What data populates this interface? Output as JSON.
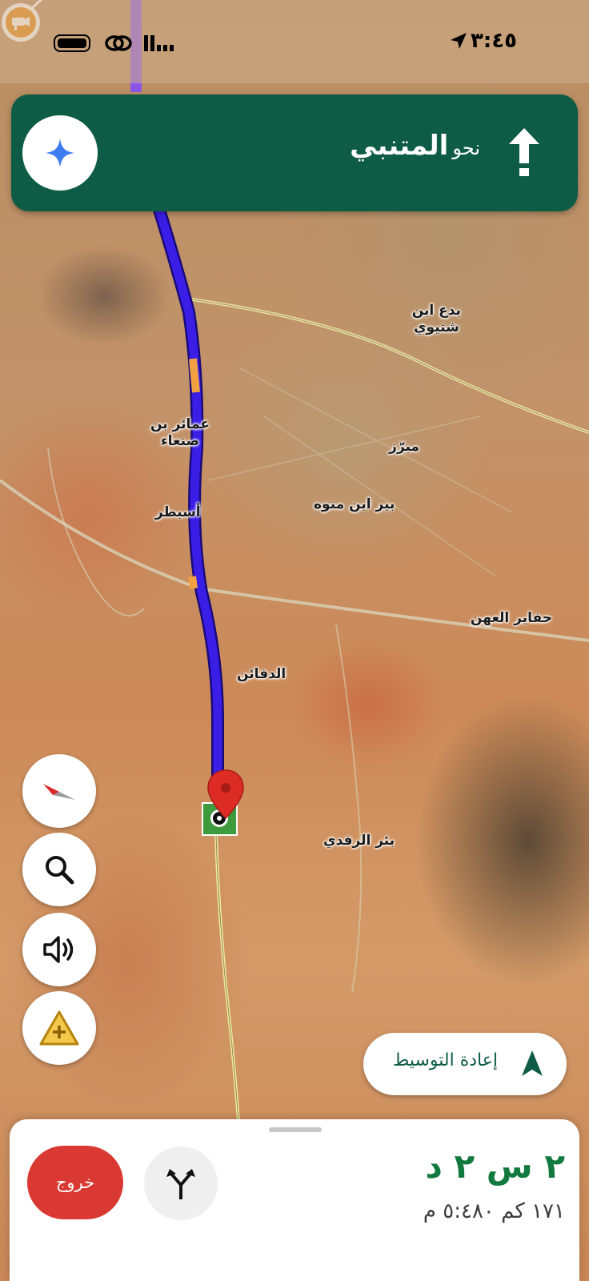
{
  "status_bar": {
    "time": "٣:٤٥"
  },
  "navigation": {
    "direction": "straight",
    "preposition": "نحو",
    "street": "المتنبي"
  },
  "map": {
    "labels": {
      "badi_ibn_shtiwi": "بدع ابن\nشتيوي",
      "amair_ibn_sanaa": "عمائر بن\nصنعاء",
      "mabraz": "مبرّز",
      "asbatar": "أسبطر",
      "bir_ibn_manwa": "بير ابن منوه",
      "hafayer_alahan": "حفاير العهن",
      "aldafaen": "الدفائن",
      "bir_alrafdi": "بئر الرفدي"
    }
  },
  "controls": {
    "recenter_label": "إعادة التوسيط"
  },
  "trip": {
    "eta": "٢ س ٢ د",
    "details": "١٧١ كم  ٥:٤٨٠ م",
    "exit_label": "خروج"
  },
  "colors": {
    "route": "#3a1ee6",
    "banner": "#0e5c45",
    "exit": "#d93932",
    "eta_text": "#127a3e",
    "pin": "#dc2c24"
  }
}
